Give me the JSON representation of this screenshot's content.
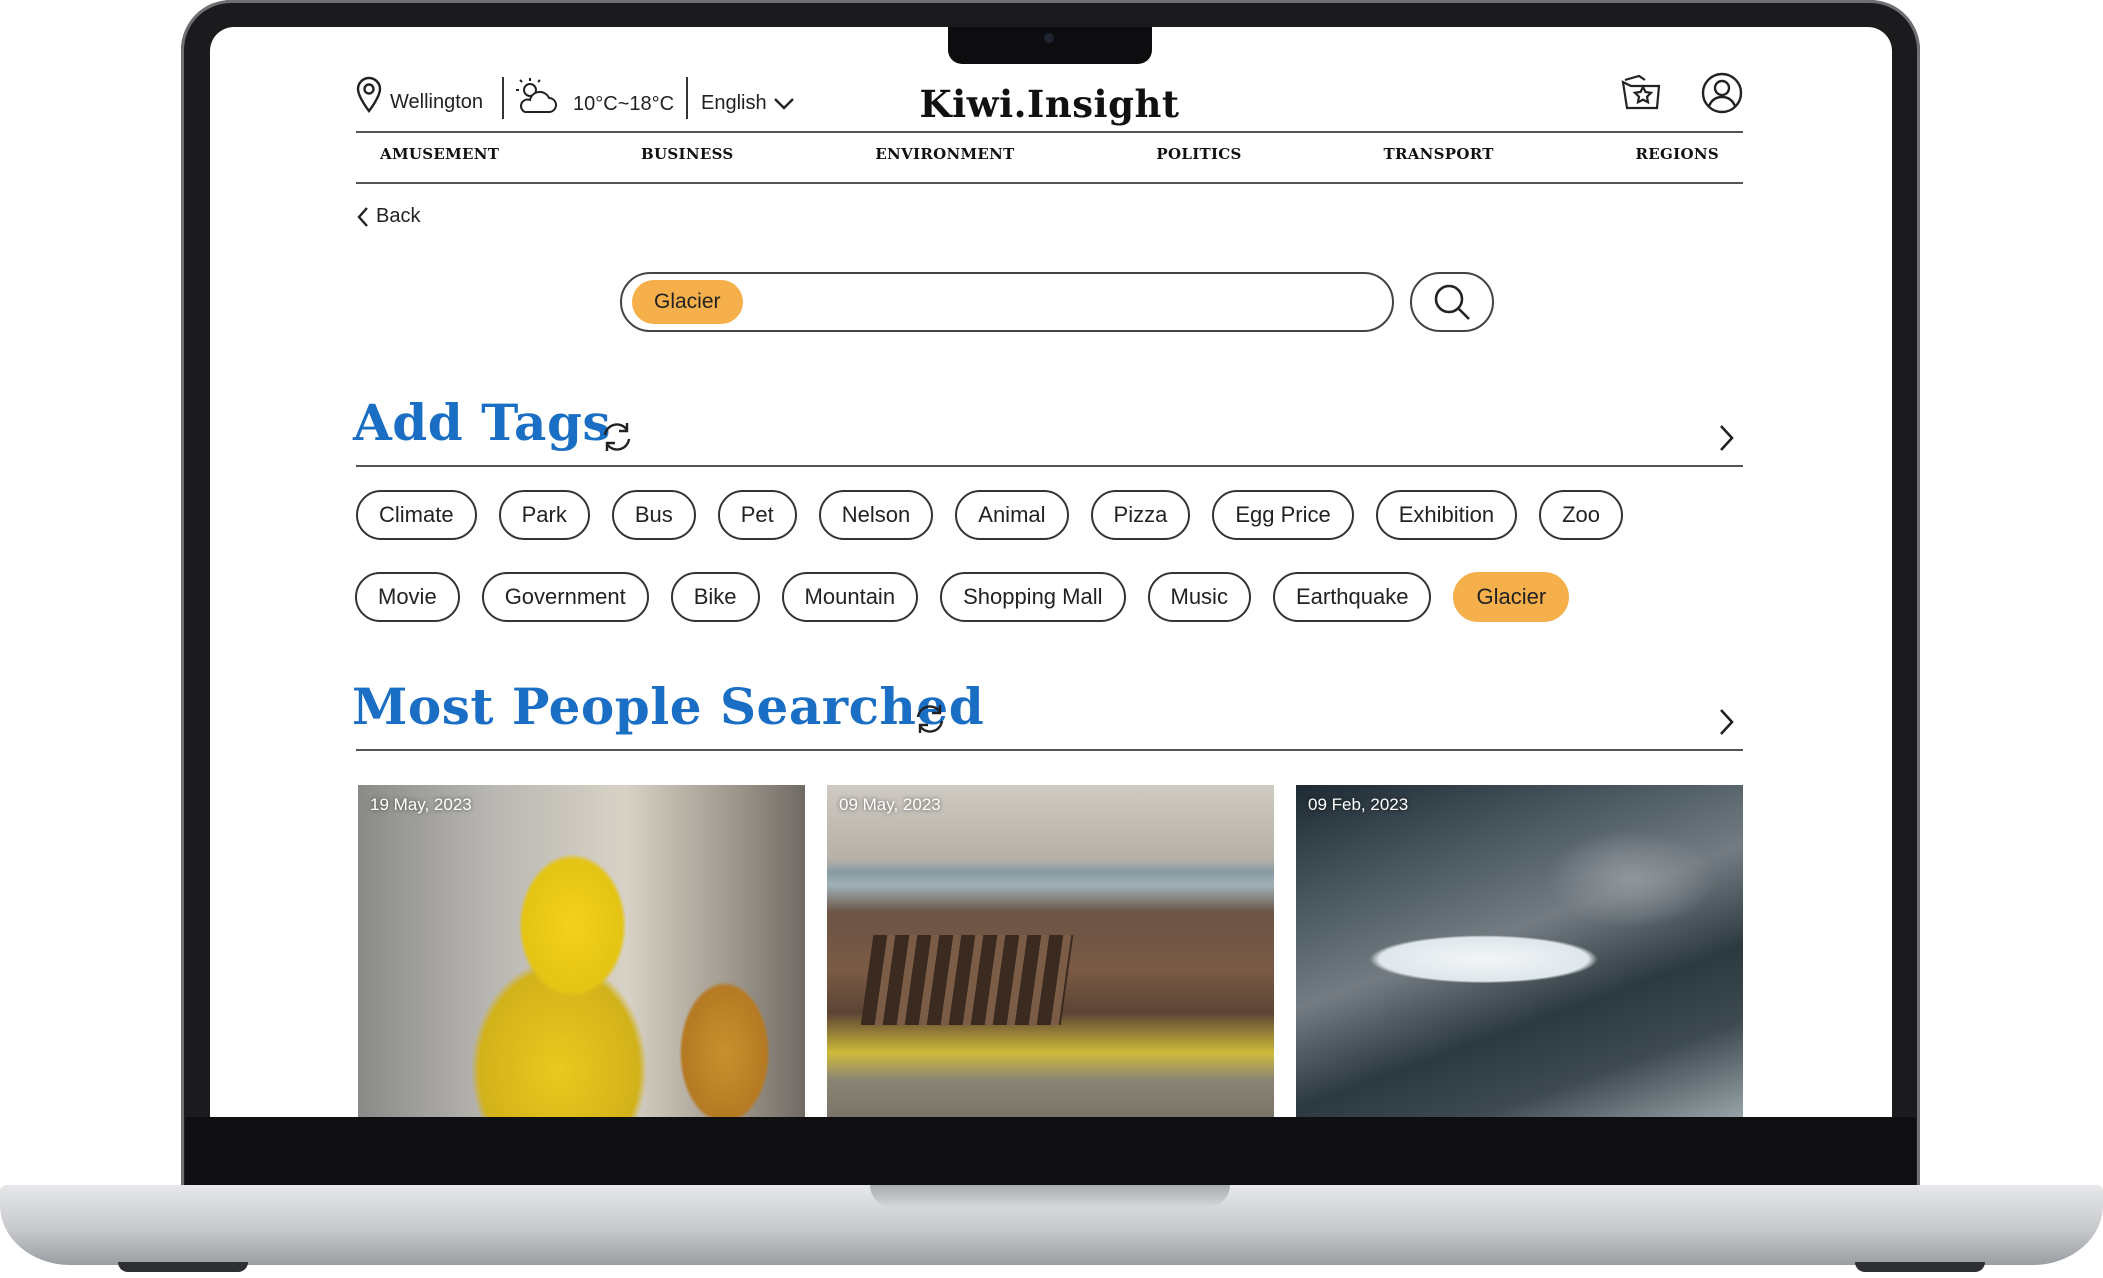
{
  "header": {
    "location": "Wellington",
    "temperature": "10°C~18°C",
    "language": "English",
    "brand": "Kiwi.Insight"
  },
  "nav": [
    "AMUSEMENT",
    "BUSINESS",
    "ENVIRONMENT",
    "POLITICS",
    "TRANSPORT",
    "REGIONS"
  ],
  "back_label": "Back",
  "search": {
    "selected_tag": "Glacier"
  },
  "add_tags": {
    "title": "Add Tags",
    "row1": [
      "Climate",
      "Park",
      "Bus",
      "Pet",
      "Nelson",
      "Animal",
      "Pizza",
      "Egg Price",
      "Exhibition",
      "Zoo"
    ],
    "row2": [
      "Movie",
      "Government",
      "Bike",
      "Mountain",
      "Shopping Mall",
      "Music",
      "Earthquake",
      "Glacier"
    ],
    "active_tag": "Glacier"
  },
  "most_searched": {
    "title": "Most People Searched",
    "cards": [
      {
        "date": "19 May, 2023"
      },
      {
        "date": "09 May, 2023"
      },
      {
        "date": "09 Feb, 2023"
      }
    ]
  },
  "colors": {
    "accent": "#1a6fc4",
    "tag_active": "#f5b04c"
  }
}
